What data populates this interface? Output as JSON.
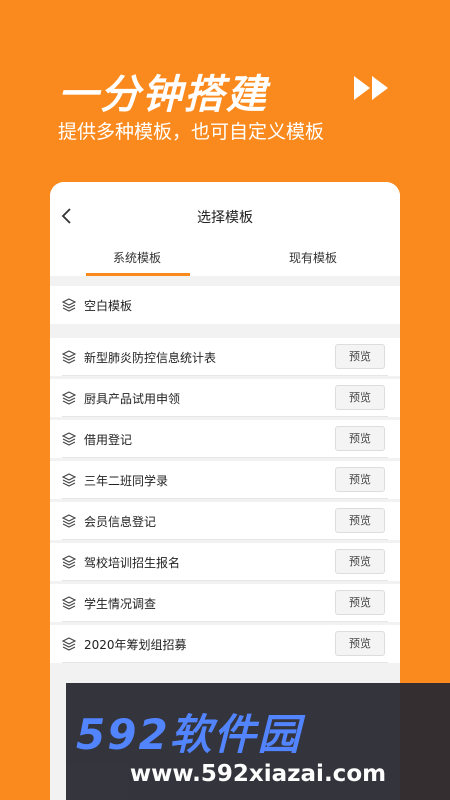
{
  "hero": {
    "title": "一分钟搭建",
    "subtitle": "提供多种模板，也可自定义模板",
    "arrow_icon": "fast-forward-icon"
  },
  "card": {
    "title": "选择模板",
    "back_icon": "chevron-left-icon",
    "tabs": [
      {
        "label": "系统模板",
        "active": true
      },
      {
        "label": "现有模板",
        "active": false
      }
    ],
    "blank_template": {
      "label": "空白模板",
      "icon": "layers-icon"
    },
    "templates": [
      {
        "label": "新型肺炎防控信息统计表",
        "action": "预览",
        "icon": "layers-icon"
      },
      {
        "label": "厨具产品试用申领",
        "action": "预览",
        "icon": "layers-icon"
      },
      {
        "label": "借用登记",
        "action": "预览",
        "icon": "layers-icon"
      },
      {
        "label": "三年二班同学录",
        "action": "预览",
        "icon": "layers-icon"
      },
      {
        "label": "会员信息登记",
        "action": "预览",
        "icon": "layers-icon"
      },
      {
        "label": "驾校培训招生报名",
        "action": "预览",
        "icon": "layers-icon"
      },
      {
        "label": "学生情况调查",
        "action": "预览",
        "icon": "layers-icon"
      },
      {
        "label": "2020年筹划组招募",
        "action": "预览",
        "icon": "layers-icon"
      }
    ]
  },
  "watermark": {
    "brand": "592软件园",
    "url": "www.592xiazai.com"
  },
  "colors": {
    "accent": "#FB8A1E",
    "background": "#f2f2f2"
  }
}
